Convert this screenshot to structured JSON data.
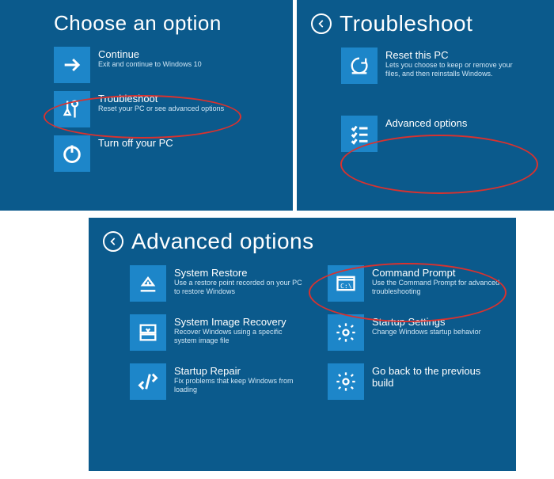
{
  "panel1": {
    "title": "Choose an option",
    "items": [
      {
        "title": "Continue",
        "sub": "Exit and continue to Windows 10",
        "icon": "arrow-right-icon"
      },
      {
        "title": "Troubleshoot",
        "sub": "Reset your PC or see advanced options",
        "icon": "tools-icon"
      },
      {
        "title": "Turn off your PC",
        "sub": "",
        "icon": "power-icon"
      }
    ]
  },
  "panel2": {
    "title": "Troubleshoot",
    "items": [
      {
        "title": "Reset this PC",
        "sub": "Lets you choose to keep or remove your files, and then reinstalls Windows.",
        "icon": "reset-icon"
      },
      {
        "title": "Advanced options",
        "sub": "",
        "icon": "checklist-icon"
      }
    ]
  },
  "panel3": {
    "title": "Advanced options",
    "col1": [
      {
        "title": "System Restore",
        "sub": "Use a restore point recorded on your PC to restore Windows",
        "icon": "restore-icon"
      },
      {
        "title": "System Image Recovery",
        "sub": "Recover Windows using a specific system image file",
        "icon": "image-recovery-icon"
      },
      {
        "title": "Startup Repair",
        "sub": "Fix problems that keep Windows from loading",
        "icon": "startup-repair-icon"
      }
    ],
    "col2": [
      {
        "title": "Command Prompt",
        "sub": "Use the Command Prompt for advanced troubleshooting",
        "icon": "command-prompt-icon"
      },
      {
        "title": "Startup Settings",
        "sub": "Change Windows startup behavior",
        "icon": "gear-icon"
      },
      {
        "title": "Go back to the previous build",
        "sub": "",
        "icon": "gear-icon"
      }
    ]
  }
}
